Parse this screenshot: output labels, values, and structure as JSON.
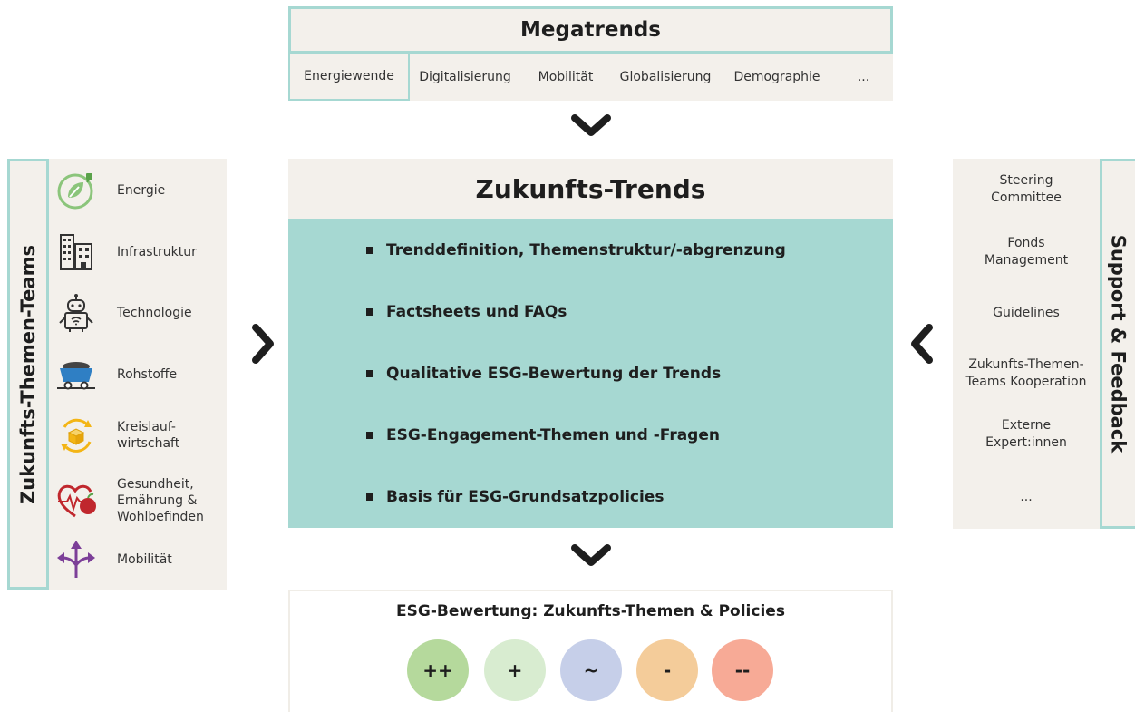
{
  "megatrends": {
    "title": "Megatrends",
    "items": [
      "Energiewende",
      "Digitalisierung",
      "Mobilität",
      "Globalisierung",
      "Demographie",
      "..."
    ]
  },
  "left_panel": {
    "label": "Zukunfts-Themen-Teams",
    "items": [
      {
        "label": "Energie",
        "icon": "energy-leaf-icon"
      },
      {
        "label": "Infrastruktur",
        "icon": "buildings-icon"
      },
      {
        "label": "Technologie",
        "icon": "robot-icon"
      },
      {
        "label": "Rohstoffe",
        "icon": "mine-cart-icon"
      },
      {
        "label": "Kreislauf-\nwirtschaft",
        "icon": "recycle-box-icon"
      },
      {
        "label": "Gesundheit,\nErnährung &\nWohlbefinden",
        "icon": "heart-pulse-icon"
      },
      {
        "label": "Mobilität",
        "icon": "route-arrows-icon"
      }
    ]
  },
  "center": {
    "title": "Zukunfts-Trends",
    "bullets": [
      "Trenddefinition, Themenstruktur/-abgrenzung",
      "Factsheets und FAQs",
      "Qualitative ESG-Bewertung der Trends",
      "ESG-Engagement-Themen und -Fragen",
      "Basis für ESG-Grundsatzpolicies"
    ]
  },
  "right_panel": {
    "label": "Support & Feedback",
    "items": [
      "Steering\nCommittee",
      "Fonds\nManagement",
      "Guidelines",
      "Zukunfts-Themen-\nTeams Kooperation",
      "Externe\nExpert:innen",
      "..."
    ]
  },
  "esg": {
    "title": "ESG-Bewertung: Zukunfts-Themen & Policies",
    "ratings": [
      {
        "label": "++",
        "color": "#b5d99c"
      },
      {
        "label": "+",
        "color": "#d8ecd0"
      },
      {
        "label": "~",
        "color": "#c6cfe9"
      },
      {
        "label": "-",
        "color": "#f4cc9a"
      },
      {
        "label": "--",
        "color": "#f7aa96"
      }
    ]
  },
  "colors": {
    "accent_teal": "#a6d8d2",
    "panel_beige": "#f3f0eb",
    "text_dark": "#1e1e1e"
  }
}
